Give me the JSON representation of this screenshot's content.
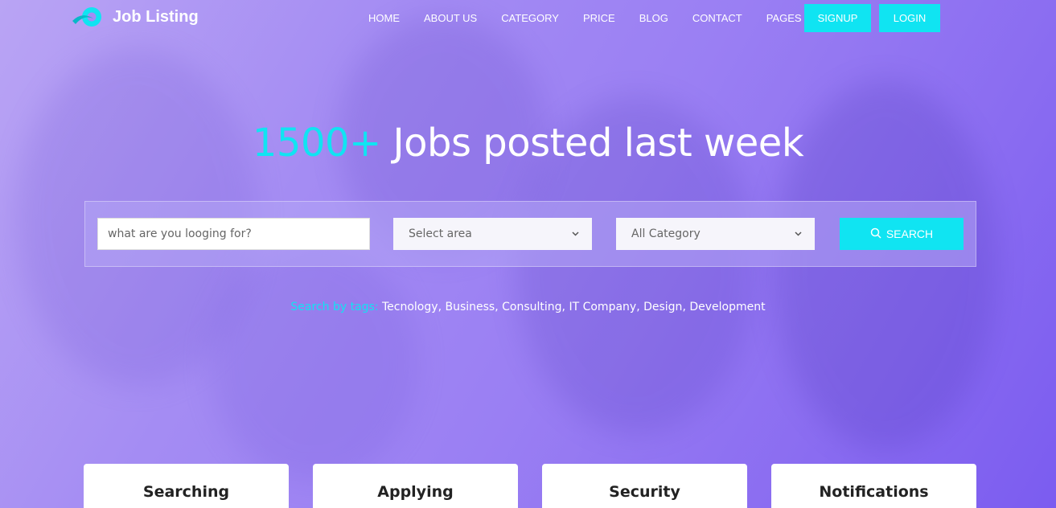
{
  "brand": {
    "name": "Job Listing",
    "accent": "#10e4f2"
  },
  "nav": {
    "items": [
      {
        "label": "HOME"
      },
      {
        "label": "ABOUT US"
      },
      {
        "label": "CATEGORY"
      },
      {
        "label": "PRICE"
      },
      {
        "label": "BLOG"
      },
      {
        "label": "CONTACT"
      },
      {
        "label": "PAGES",
        "has_dropdown": true
      }
    ],
    "signup_label": "SIGNUP",
    "login_label": "LOGIN"
  },
  "hero": {
    "title_accent": "1500+",
    "title_rest": " Jobs posted last week"
  },
  "search": {
    "keyword_placeholder": "what are you looging for?",
    "area_selected": "Select area",
    "category_selected": "All Category",
    "button_label": "SEARCH"
  },
  "tags": {
    "label": "Search by tags:",
    "items": [
      "Tecnology",
      "Business",
      "Consulting",
      "IT Company",
      "Design",
      "Development"
    ]
  },
  "features": [
    {
      "title": "Searching"
    },
    {
      "title": "Applying"
    },
    {
      "title": "Security"
    },
    {
      "title": "Notifications"
    }
  ]
}
